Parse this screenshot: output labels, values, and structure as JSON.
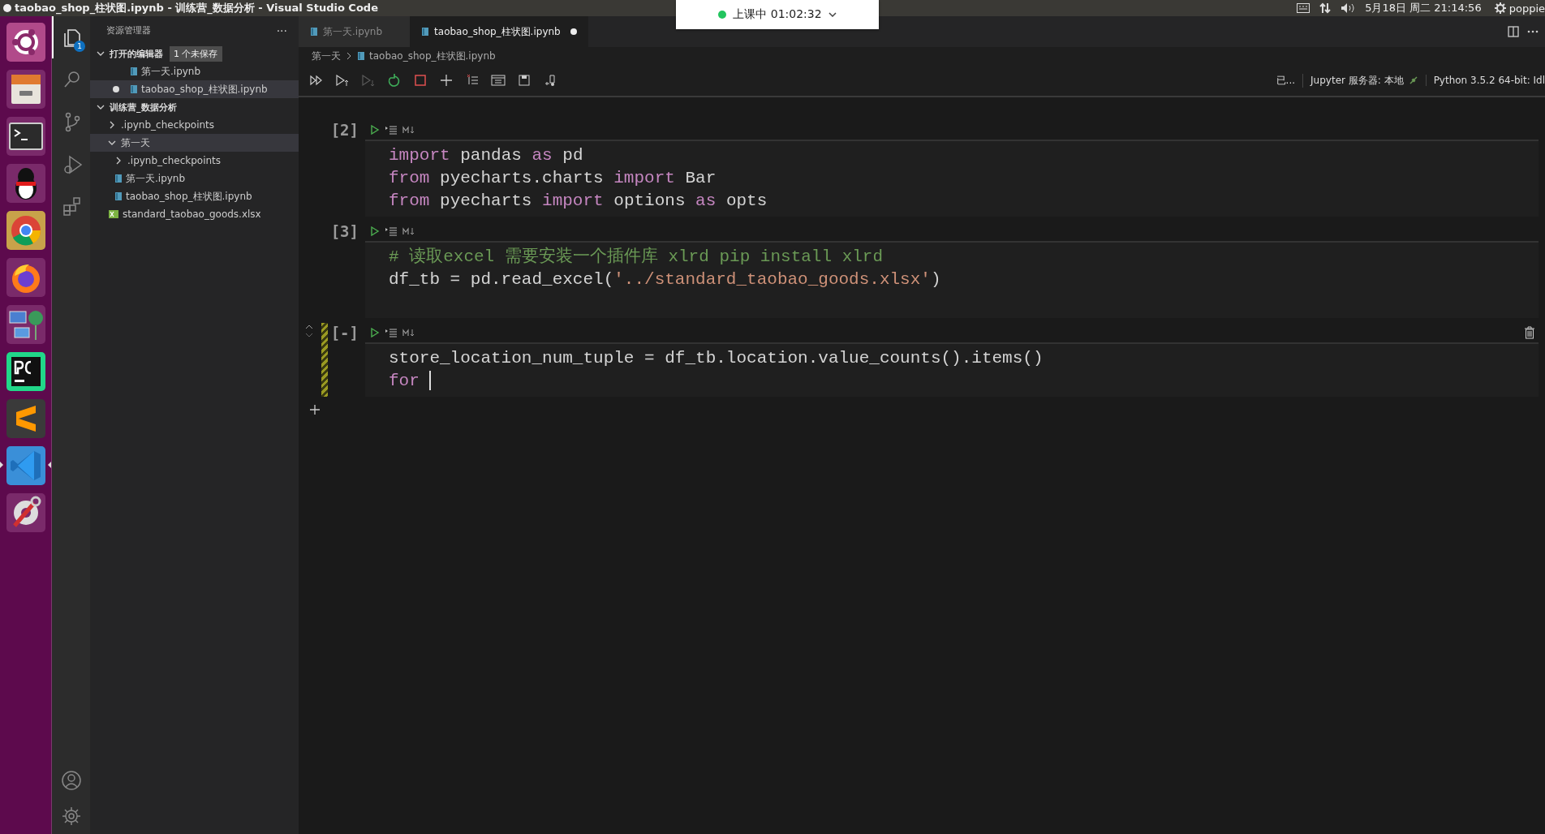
{
  "window": {
    "title": "taobao_shop_柱状图.ipynb - 训练营_数据分析 - Visual Studio Code"
  },
  "class_timer": {
    "label": "上课中 01:02:32"
  },
  "system_tray": {
    "datetime": "5月18日 周二 21:14:56",
    "user": "poppie"
  },
  "dock": [
    {
      "kind": "ubuntu",
      "active": false
    },
    {
      "kind": "files",
      "active": false
    },
    {
      "kind": "terminal",
      "active": false
    },
    {
      "kind": "penguin",
      "active": false
    },
    {
      "kind": "chrome",
      "active": false
    },
    {
      "kind": "firefox",
      "active": false
    },
    {
      "kind": "network",
      "active": false
    },
    {
      "kind": "pycharm",
      "active": false
    },
    {
      "kind": "sublime",
      "active": false
    },
    {
      "kind": "vscode",
      "active": true
    },
    {
      "kind": "tool",
      "active": false
    }
  ],
  "activity_bar": {
    "items": [
      {
        "kind": "explorer",
        "selected": true,
        "badge": "1"
      },
      {
        "kind": "search",
        "selected": false
      },
      {
        "kind": "scm",
        "selected": false
      },
      {
        "kind": "debug",
        "selected": false
      },
      {
        "kind": "extensions",
        "selected": false
      }
    ],
    "bottom": [
      {
        "kind": "account"
      },
      {
        "kind": "settings"
      }
    ]
  },
  "explorer": {
    "title": "资源管理器",
    "more": "···",
    "open_editors": {
      "label": "打开的编辑器",
      "badge": "1 个未保存",
      "expanded": true,
      "items": [
        {
          "name": "第一天.ipynb",
          "dirty": false,
          "selected": false
        },
        {
          "name": "taobao_shop_柱状图.ipynb",
          "dirty": true,
          "selected": true
        }
      ]
    },
    "workspace": {
      "label": "训练营_数据分析",
      "expanded": true,
      "children": [
        {
          "name": ".ipynb_checkpoints",
          "kind": "folder",
          "expanded": false,
          "selected": false
        },
        {
          "name": "第一天",
          "kind": "folder",
          "expanded": true,
          "selected": true,
          "children": [
            {
              "name": ".ipynb_checkpoints",
              "kind": "folder",
              "expanded": false,
              "selected": false
            },
            {
              "name": "第一天.ipynb",
              "kind": "notebook",
              "selected": false
            },
            {
              "name": "taobao_shop_柱状图.ipynb",
              "kind": "notebook",
              "selected": false
            }
          ]
        },
        {
          "name": "standard_taobao_goods.xlsx",
          "kind": "excel",
          "selected": false
        }
      ]
    }
  },
  "tabs": [
    {
      "label": "第一天.ipynb",
      "selected": false,
      "dirty": false
    },
    {
      "label": "taobao_shop_柱状图.ipynb",
      "selected": true,
      "dirty": true
    }
  ],
  "breadcrumb": [
    "第一天",
    "taobao_shop_柱状图.ipynb"
  ],
  "toolbar": [
    {
      "kind": "run-all",
      "disabled": false
    },
    {
      "kind": "run-above",
      "disabled": false
    },
    {
      "kind": "run-below",
      "disabled": true
    },
    {
      "kind": "restart",
      "disabled": false
    },
    {
      "kind": "interrupt",
      "disabled": false
    },
    {
      "kind": "add",
      "disabled": false
    },
    {
      "kind": "clear",
      "disabled": false
    },
    {
      "kind": "variables",
      "disabled": false
    },
    {
      "kind": "save",
      "disabled": false
    },
    {
      "kind": "export",
      "disabled": false
    }
  ],
  "status": {
    "trust": "已...",
    "server": "Jupyter 服务器: 本地",
    "kernel": "Python 3.5.2 64-bit: Idl"
  },
  "cells": [
    {
      "count": "[2]",
      "editing": false,
      "lines": [
        [
          {
            "t": "import",
            "kind": "kw"
          },
          {
            "t": " pandas ",
            "kind": "plain"
          },
          {
            "t": "as",
            "kind": "kw"
          },
          {
            "t": " pd",
            "kind": "plain"
          }
        ],
        [
          {
            "t": "from",
            "kind": "kw"
          },
          {
            "t": " pyecharts.charts ",
            "kind": "plain"
          },
          {
            "t": "import",
            "kind": "kw"
          },
          {
            "t": " Bar",
            "kind": "plain"
          }
        ],
        [
          {
            "t": "from",
            "kind": "kw"
          },
          {
            "t": " pyecharts ",
            "kind": "plain"
          },
          {
            "t": "import",
            "kind": "kw"
          },
          {
            "t": " options ",
            "kind": "plain"
          },
          {
            "t": "as",
            "kind": "kw"
          },
          {
            "t": " opts",
            "kind": "plain"
          }
        ]
      ]
    },
    {
      "count": "[3]",
      "editing": false,
      "lines": [
        [
          {
            "t": "# 读取excel 需要安装一个插件库 xlrd pip install xlrd",
            "kind": "comment"
          }
        ],
        [
          {
            "t": "df_tb = pd.read_excel(",
            "kind": "plain"
          },
          {
            "t": "'../standard_taobao_goods.xlsx'",
            "kind": "string"
          },
          {
            "t": ")",
            "kind": "plain"
          }
        ]
      ]
    },
    {
      "count": "[-]",
      "editing": true,
      "lines": [
        [
          {
            "t": "store_location_num_tuple = df_tb.location.value_counts().items()",
            "kind": "plain"
          }
        ],
        [
          {
            "t": "for ",
            "kind": "kw"
          }
        ]
      ]
    }
  ]
}
